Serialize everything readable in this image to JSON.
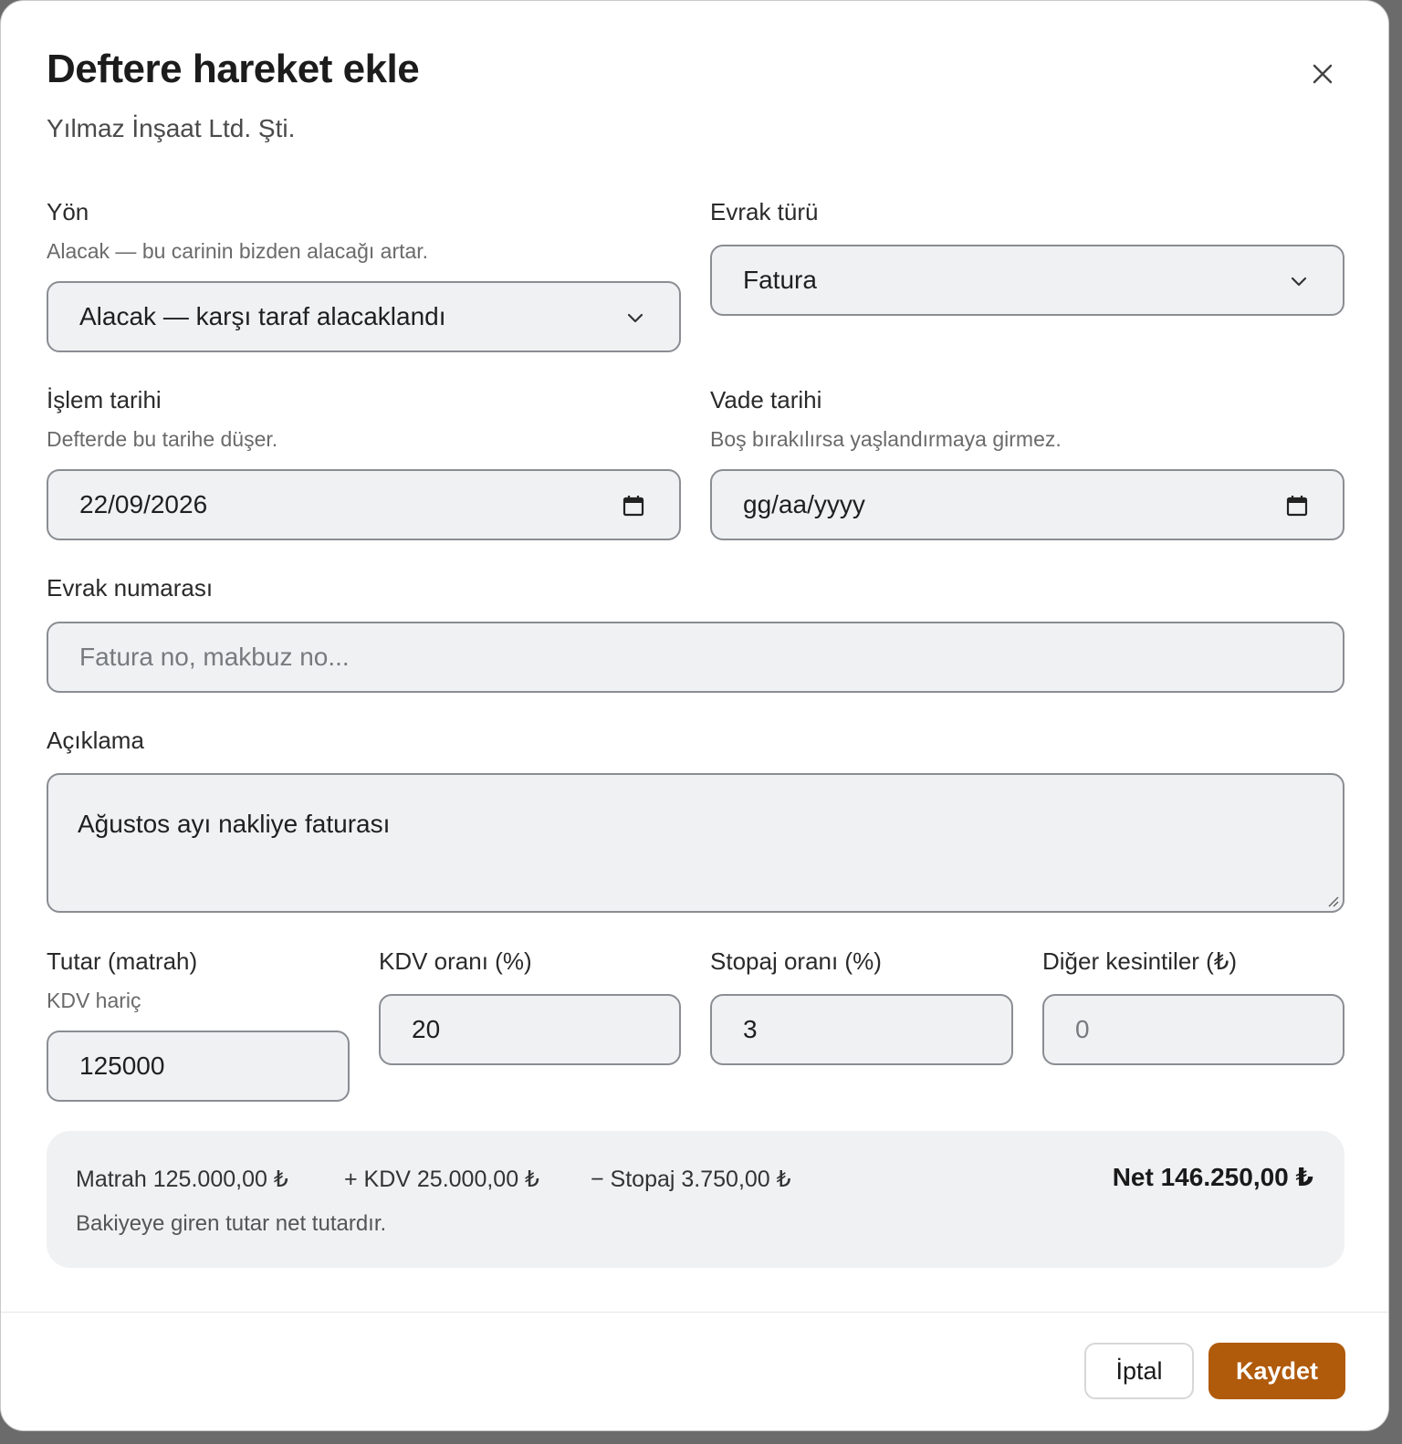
{
  "dialog": {
    "title": "Deftere hareket ekle",
    "subtitle": "Yılmaz İnşaat Ltd. Şti."
  },
  "form": {
    "direction": {
      "label": "Yön",
      "hint": "Alacak — bu carinin bizden alacağı artar.",
      "value": "Alacak — karşı taraf alacaklandı"
    },
    "doc_type": {
      "label": "Evrak türü",
      "value": "Fatura"
    },
    "tx_date": {
      "label": "İşlem tarihi",
      "hint": "Defterde bu tarihe düşer.",
      "value": "22/09/2026"
    },
    "due_date": {
      "label": "Vade tarihi",
      "hint": "Boş bırakılırsa yaşlandırmaya girmez.",
      "placeholder": "gg/aa/yyyy"
    },
    "doc_number": {
      "label": "Evrak numarası",
      "placeholder": "Fatura no, makbuz no..."
    },
    "description": {
      "label": "Açıklama",
      "value": "Ağustos ayı nakliye faturası"
    },
    "amount": {
      "label": "Tutar (matrah)",
      "hint": "KDV hariç",
      "value": "125000"
    },
    "vat_rate": {
      "label": "KDV oranı (%)",
      "value": "20"
    },
    "withholding_rate": {
      "label": "Stopaj oranı (%)",
      "value": "3"
    },
    "other_deductions": {
      "label": "Diğer kesintiler (₺)",
      "placeholder": "0"
    }
  },
  "summary": {
    "base": "Matrah 125.000,00 ₺",
    "vat": "+ KDV 25.000,00 ₺",
    "withholding": "− Stopaj 3.750,00 ₺",
    "net": "Net 146.250,00 ₺",
    "note": "Bakiyeye giren tutar net tutardır."
  },
  "actions": {
    "cancel": "İptal",
    "save": "Kaydet"
  },
  "colors": {
    "accent": "#b05a0c",
    "field_bg": "#f0f1f3",
    "field_border": "#8a8d92"
  }
}
